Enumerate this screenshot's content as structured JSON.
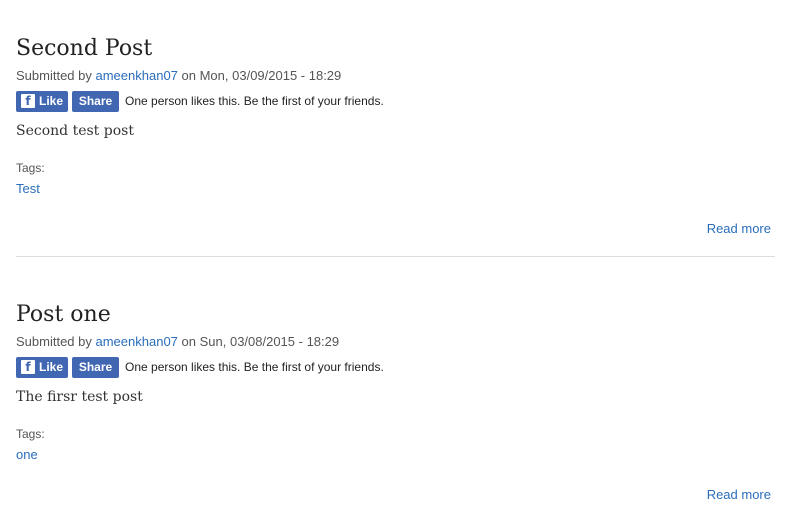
{
  "posts": [
    {
      "title": "Second Post",
      "submitted_by": "Submitted by",
      "author": "ameenkhan07",
      "on_date": "on Mon, 03/09/2015 - 18:29",
      "fb_like_label": "Like",
      "fb_share_label": "Share",
      "fb_icon": "f",
      "fb_text": "One person likes this. Be the first of your friends.",
      "body": "Second test post",
      "tags_label": "Tags:",
      "tag": "Test",
      "read_more": "Read more"
    },
    {
      "title": "Post one",
      "submitted_by": "Submitted by",
      "author": "ameenkhan07",
      "on_date": "on Sun, 03/08/2015 - 18:29",
      "fb_like_label": "Like",
      "fb_share_label": "Share",
      "fb_icon": "f",
      "fb_text": "One person likes this. Be the first of your friends.",
      "body": "The firsr test post",
      "tags_label": "Tags:",
      "tag": "one",
      "read_more": "Read more"
    }
  ],
  "colors": {
    "link": "#2a6ebb",
    "facebook": "#4267b2",
    "divider": "#dddddd"
  }
}
